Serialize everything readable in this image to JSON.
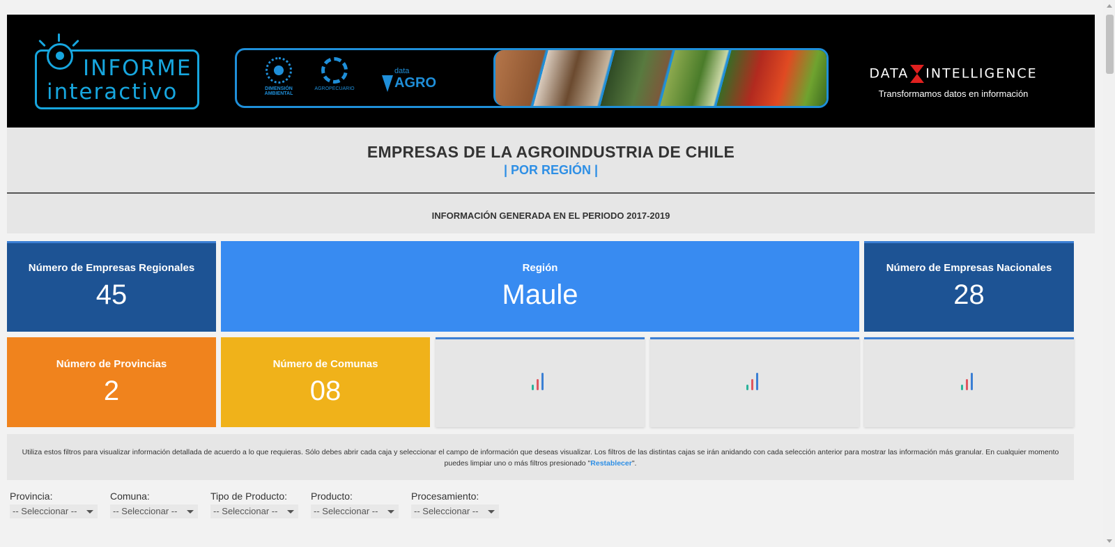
{
  "banner": {
    "logo_line1": "INFORME",
    "logo_line2": "interactivo",
    "partner1": "DIMENSIÓN AMBIENTAL",
    "partner2": "AGROPECUARIO",
    "dataagro_small": "data",
    "dataagro_big": "AGRO",
    "di_word_left": "DATA",
    "di_word_right": "INTELLIGENCE",
    "di_tagline": "Transformamos datos en información"
  },
  "title": {
    "main": "EMPRESAS DE LA AGROINDUSTRIA DE CHILE",
    "sub": "| POR REGIÓN |",
    "period": "INFORMACIÓN GENERADA EN EL PERIODO 2017-2019"
  },
  "kpis": {
    "regional_label": "Número de Empresas Regionales",
    "regional_value": "45",
    "region_label": "Región",
    "region_value": "Maule",
    "national_label": "Número de Empresas Nacionales",
    "national_value": "28",
    "provinces_label": "Número de Provincias",
    "provinces_value": "2",
    "communes_label": "Número de Comunas",
    "communes_value": "08"
  },
  "notice": {
    "text": "Utiliza estos filtros para visualizar información detallada de acuerdo a lo que requieras. Sólo debes abrir cada caja y seleccionar el campo de información que deseas visualizar. Los filtros de las distintas cajas se irán anidando con cada selección anterior para mostrar las información más granular. En cualquier momento puedes limpiar uno o más filtros presionado \"",
    "link": "Restablecer",
    "tail": "\"."
  },
  "filters": [
    {
      "label": "Provincia:",
      "value": "-- Seleccionar --"
    },
    {
      "label": "Comuna:",
      "value": "-- Seleccionar --"
    },
    {
      "label": "Tipo de Producto:",
      "value": "-- Seleccionar --"
    },
    {
      "label": "Producto:",
      "value": "-- Seleccionar --"
    },
    {
      "label": "Procesamiento:",
      "value": "-- Seleccionar --"
    }
  ],
  "colors": {
    "navy": "#1d5394",
    "sky": "#388bf1",
    "orange": "#f0831d",
    "amber": "#f0b21a",
    "accent": "#2e8fe5"
  },
  "icons": [
    "bar-chart-icon",
    "lightbulb-icon",
    "chevron-down-icon"
  ]
}
